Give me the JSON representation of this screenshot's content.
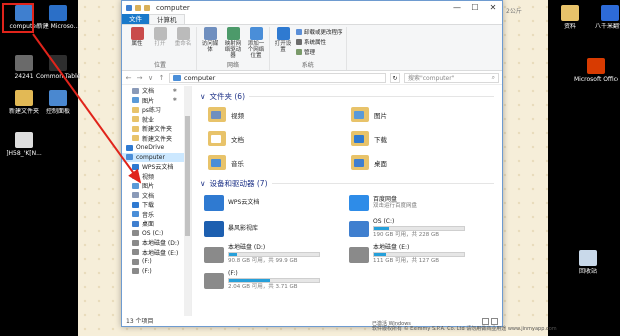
{
  "desktop": {
    "left_icons": [
      {
        "label": "computer",
        "color": "#3f7fcf"
      },
      {
        "label": "新建 Microso...",
        "color": "#2b6fc7"
      },
      {
        "label": "24241",
        "color": "#6a6a6a"
      },
      {
        "label": "Common Tablet",
        "color": "#2e2e2e"
      },
      {
        "label": "新建文件夹",
        "color": "#e2b955"
      },
      {
        "label": "控制面板",
        "color": "#4a88d0"
      },
      {
        "label": "]H58_'K[N...",
        "color": "#dddddd"
      }
    ],
    "right_icons": [
      {
        "label": "资料",
        "color": "#e8c36a"
      },
      {
        "label": "八千米翻译",
        "color": "#2d6bd8"
      },
      {
        "label": "Microsoft Office",
        "color": "#d83b01"
      },
      {
        "label": "回收站",
        "color": "#c9d9ea"
      }
    ],
    "corner_text": "2公斤"
  },
  "window": {
    "title": "computer",
    "controls": [
      "—",
      "☐",
      "✕"
    ],
    "tabs": [
      "文件",
      "计算机"
    ],
    "ribbon": {
      "groups": [
        {
          "name": "位置",
          "buttons": [
            {
              "label": "属性",
              "icon": "#c94b4b",
              "dim": false
            },
            {
              "label": "打开",
              "icon": "#bbbbbb",
              "dim": true
            },
            {
              "label": "重命名",
              "icon": "#bbbbbb",
              "dim": true
            }
          ]
        },
        {
          "name": "网络",
          "buttons": [
            {
              "label": "访问媒体",
              "icon": "#6f8fbf",
              "dim": false
            },
            {
              "label": "映射网络驱动器",
              "icon": "#4c9a6a",
              "dim": false
            },
            {
              "label": "添加一个网络位置",
              "icon": "#4a8ed8",
              "dim": false
            }
          ]
        },
        {
          "name": "系统",
          "buttons": [
            {
              "label": "打开设置",
              "icon": "#2f7ad1",
              "dim": false
            }
          ]
        }
      ],
      "system_items": [
        {
          "label": "卸载或更改程序",
          "color": "#5b8fd8"
        },
        {
          "label": "系统属性",
          "color": "#6c6c6c"
        },
        {
          "label": "管理",
          "color": "#7a9a6a"
        }
      ]
    },
    "address": {
      "back": "←",
      "forward": "→",
      "down": "∨",
      "up": "↑",
      "path": "computer",
      "refresh": "↻",
      "search_placeholder": "搜索\"computer\""
    },
    "nav": [
      {
        "label": "文档",
        "level": 2,
        "color": "#8a9ab8",
        "pinned": true
      },
      {
        "label": "图片",
        "level": 2,
        "color": "#5a9ad8",
        "pinned": true
      },
      {
        "label": "ps练习",
        "level": 2,
        "color": "#e8c36a",
        "pinned": false
      },
      {
        "label": "就业",
        "level": 2,
        "color": "#e8c36a",
        "pinned": false
      },
      {
        "label": "新建文件夹",
        "level": 2,
        "color": "#e8c36a",
        "pinned": false
      },
      {
        "label": "新建文件夹",
        "level": 2,
        "color": "#e8c36a",
        "pinned": false
      },
      {
        "label": "OneDrive",
        "level": 1,
        "color": "#2f7ad1",
        "pinned": false
      },
      {
        "label": "computer",
        "level": 1,
        "color": "#4a8ed8",
        "pinned": false,
        "selected": true
      },
      {
        "label": "WPS云文档",
        "level": 2,
        "color": "#2f7ad1",
        "pinned": false
      },
      {
        "label": "视频",
        "level": 2,
        "color": "#6f8fbf",
        "pinned": false
      },
      {
        "label": "图片",
        "level": 2,
        "color": "#5a9ad8",
        "pinned": false
      },
      {
        "label": "文档",
        "level": 2,
        "color": "#8a9ab8",
        "pinned": false
      },
      {
        "label": "下载",
        "level": 2,
        "color": "#2f7ad1",
        "pinned": false
      },
      {
        "label": "音乐",
        "level": 2,
        "color": "#4a8ed8",
        "pinned": false
      },
      {
        "label": "桌面",
        "level": 2,
        "color": "#3f7fcf",
        "pinned": false
      },
      {
        "label": "OS (C:)",
        "level": 2,
        "color": "#8a8a8a",
        "pinned": false
      },
      {
        "label": "本地磁盘 (D:)",
        "level": 2,
        "color": "#8a8a8a",
        "pinned": false
      },
      {
        "label": "本地磁盘 (E:)",
        "level": 2,
        "color": "#8a8a8a",
        "pinned": false
      },
      {
        "label": "(F:)",
        "level": 2,
        "color": "#8a8a8a",
        "pinned": false
      },
      {
        "label": "(F:)",
        "level": 2,
        "color": "#8a8a8a",
        "pinned": false
      }
    ],
    "folders_header": "文件夹 (6)",
    "folders": [
      {
        "label": "视频",
        "color": "#e8c36a",
        "overlay": "#6f8fbf"
      },
      {
        "label": "图片",
        "color": "#e8c36a",
        "overlay": "#5a9ad8"
      },
      {
        "label": "文档",
        "color": "#e8c36a",
        "overlay": "#ffffff"
      },
      {
        "label": "下载",
        "color": "#e8c36a",
        "overlay": "#2f7ad1"
      },
      {
        "label": "音乐",
        "color": "#e8c36a",
        "overlay": "#4a8ed8"
      },
      {
        "label": "桌面",
        "color": "#e8c36a",
        "overlay": "#3f7fcf"
      }
    ],
    "devices_header": "设备和驱动器 (7)",
    "devices": [
      {
        "name": "WPS云文档",
        "sub": "",
        "usage": null,
        "color": "#2f7ad1"
      },
      {
        "name": "百度网盘",
        "sub": "双击运行百度网盘",
        "usage": null,
        "color": "#2e8ce8"
      },
      {
        "name": "暴风影视库",
        "sub": "",
        "usage": null,
        "color": "#1d5fb0"
      },
      {
        "name": "OS (C:)",
        "sub": "190 GB 可用，共 228 GB",
        "usage": 0.17,
        "color": "#3f7fcf"
      },
      {
        "name": "本地磁盘 (D:)",
        "sub": "90.8 GB 可用，共 99.9 GB",
        "usage": 0.09,
        "color": "#8a8a8a"
      },
      {
        "name": "本地磁盘 (E:)",
        "sub": "111 GB 可用，共 127 GB",
        "usage": 0.13,
        "color": "#8a8a8a"
      },
      {
        "name": "(F:)",
        "sub": "2.04 GB 可用，共 3.71 GB",
        "usage": 0.45,
        "color": "#8a8a8a"
      }
    ],
    "status": "13 个项目"
  },
  "watermark": [
    "已激活 Windows",
    "软件版权所有 © Eximmy S.P.A. Co. Ltd 请勿用做商业用途 www.jinmyapp.com"
  ]
}
